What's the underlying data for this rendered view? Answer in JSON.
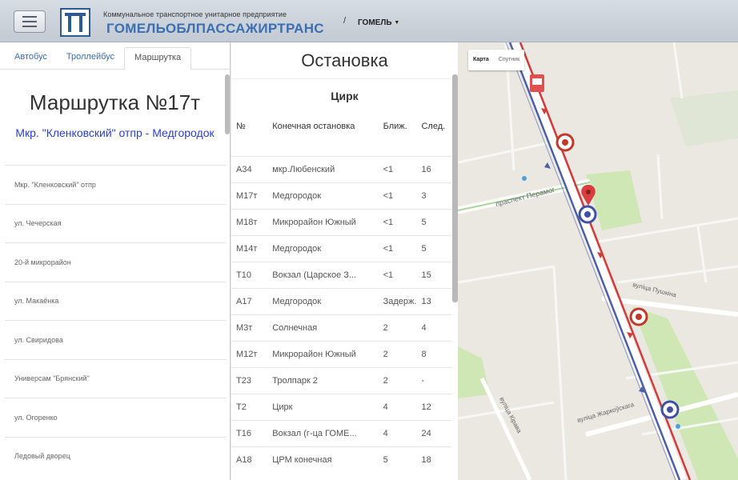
{
  "header": {
    "org_small": "Коммунальное транспортное унитарное предприятие",
    "org_name": "ГОМЕЛЬОБЛПАССАЖИРТРАНС",
    "separator": "/",
    "city": "ГОМЕЛЬ"
  },
  "tabs": [
    {
      "label": "Автобус"
    },
    {
      "label": "Троллейбус"
    },
    {
      "label": "Маршрутка"
    }
  ],
  "route": {
    "title": "Маршрутка №17т",
    "subtitle": "Мкр. \"Кленковский\" отпр - Медгородок",
    "stops": [
      "Мкр. \"Кленковский\" отпр",
      "ул. Чечерская",
      "20-й микрорайон",
      "ул. Макаёнка",
      "ул. Свиридова",
      "Универсам \"Брянский\"",
      "ул. Огоренко",
      "Ледовый дворец"
    ]
  },
  "stop_panel": {
    "title": "Остановка",
    "stop_name": "Цирк",
    "columns": [
      "№",
      "Конечная остановка",
      "Ближ.",
      "След."
    ],
    "rows": [
      [
        "А34",
        "мкр.Любенский",
        "<1",
        "16"
      ],
      [
        "М17т",
        "Медгородок",
        "<1",
        "3"
      ],
      [
        "М18т",
        "Микрорайон Южный",
        "<1",
        "5"
      ],
      [
        "М14т",
        "Медгородок",
        "<1",
        "5"
      ],
      [
        "Т10",
        "Вокзал (Царское З...",
        "<1",
        "15"
      ],
      [
        "А17",
        "Медгородок",
        "Задерж.",
        "13"
      ],
      [
        "М3т",
        "Солнечная",
        "2",
        "4"
      ],
      [
        "М12т",
        "Микрорайон Южный",
        "2",
        "8"
      ],
      [
        "Т23",
        "Тролпарк 2",
        "2",
        "-"
      ],
      [
        "Т2",
        "Цирк",
        "4",
        "12"
      ],
      [
        "Т16",
        "Вокзал (г-ца ГОМЕ...",
        "4",
        "24"
      ],
      [
        "А18",
        "ЦРМ конечная",
        "5",
        "18"
      ]
    ]
  },
  "map": {
    "type_buttons": [
      "Карта",
      "Спутник"
    ],
    "street_labels": [
      "праспект Перамог",
      "вуліца Пушкіна",
      "вуліца Жаркоўскага",
      "вуліца Кірава"
    ],
    "colors": {
      "route_red": "#d23b3b",
      "route_blue": "#4b5fa8",
      "park": "#cfe7b4",
      "road": "#ffffff"
    }
  }
}
